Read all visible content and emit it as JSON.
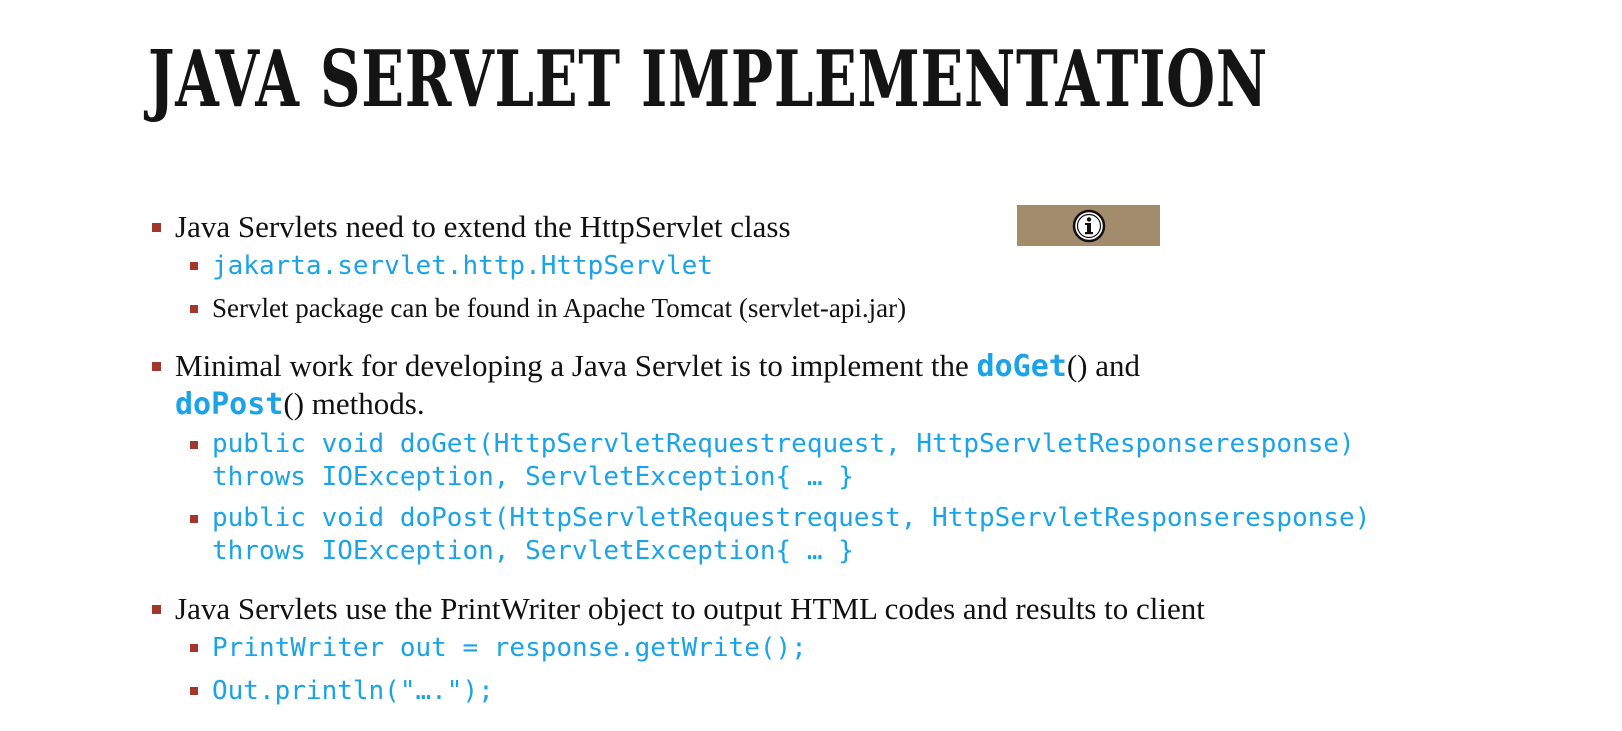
{
  "slide": {
    "title": "Java Servlet Implementation",
    "info_icon": "info-circle-icon",
    "accent_color": "#a38c6c",
    "bullet_color": "#a0372a",
    "code_color": "#1aa3e8",
    "bullets": [
      {
        "text": "Java Servlets need to extend the HttpServlet class",
        "sub": [
          {
            "code": "jakarta.servlet.http.HttpServlet"
          },
          {
            "text": "Servlet package can be found in Apache Tomcat (servlet-api.jar)"
          }
        ]
      },
      {
        "text_a": "Minimal work for developing a Java Servlet is to implement the ",
        "code_a": "doGet",
        "text_b": "() and",
        "code_b": "doPost",
        "text_c": "() methods.",
        "sub": [
          {
            "code_line1": "public void doGet(HttpServletRequestrequest, HttpServletResponseresponse)",
            "code_line2": "throws IOException, ServletException{ … }"
          },
          {
            "code_line1": "public void doPost(HttpServletRequestrequest, HttpServletResponseresponse)",
            "code_line2": "throws IOException, ServletException{ … }"
          }
        ]
      },
      {
        "text": "Java Servlets use the PrintWriter object to output HTML codes and results to client",
        "sub": [
          {
            "code": "PrintWriter out = response.getWrite();"
          },
          {
            "code": "Out.println(\"….\");"
          }
        ]
      }
    ]
  }
}
